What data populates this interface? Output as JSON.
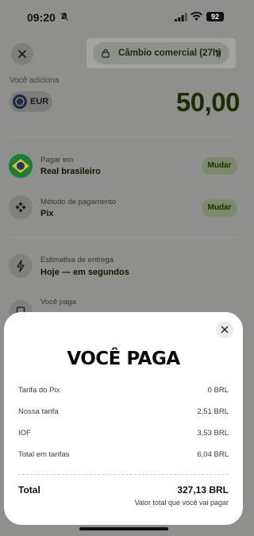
{
  "status_bar": {
    "time": "09:20",
    "battery": "92"
  },
  "header": {
    "exchange_rate_label": "Câmbio comercial (27h)"
  },
  "add": {
    "label": "Você adiciona",
    "currency": "EUR",
    "amount": "50,00"
  },
  "rows": {
    "pay_in": {
      "label": "Pagar em",
      "value": "Real brasileiro",
      "action": "Mudar"
    },
    "method": {
      "label": "Método de pagamento",
      "value": "Pix",
      "action": "Mudar"
    },
    "delivery": {
      "label": "Estimativa de entrega",
      "value": "Hoje — em segundos"
    },
    "you_pay": {
      "label": "Você paga"
    }
  },
  "sheet": {
    "title": "VOCÊ PAGA",
    "lines": [
      {
        "label": "Tarifa do Pix",
        "value": "0 BRL"
      },
      {
        "label": "Nossa tarifa",
        "value": "2,51 BRL"
      },
      {
        "label": "IOF",
        "value": "3,53 BRL"
      },
      {
        "label": "Total em tarifas",
        "value": "6,04 BRL"
      }
    ],
    "total_label": "Total",
    "total_value": "327,13 BRL",
    "total_note": "Valor total que você vai pagar"
  }
}
